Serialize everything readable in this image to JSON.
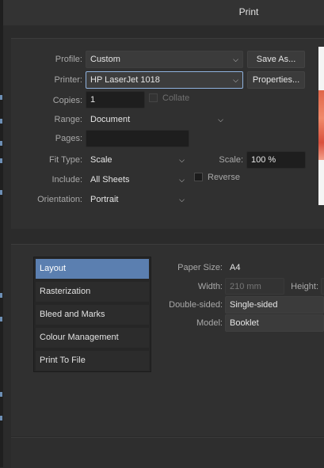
{
  "window": {
    "title": "Print"
  },
  "settings": {
    "profile": {
      "label": "Profile:",
      "value": "Custom"
    },
    "save_as_label": "Save As...",
    "printer": {
      "label": "Printer:",
      "value": "HP LaserJet 1018"
    },
    "properties_label": "Properties...",
    "copies": {
      "label": "Copies:",
      "value": "1"
    },
    "collate_label": "Collate",
    "range": {
      "label": "Range:",
      "value": "Document"
    },
    "pages": {
      "label": "Pages:",
      "value": ""
    },
    "fit_type": {
      "label": "Fit Type:",
      "value": "Scale"
    },
    "scale": {
      "label": "Scale:",
      "value": "100 %"
    },
    "include": {
      "label": "Include:",
      "value": "All Sheets"
    },
    "reverse_label": "Reverse",
    "orientation": {
      "label": "Orientation:",
      "value": "Portrait"
    }
  },
  "categories": [
    "Layout",
    "Rasterization",
    "Bleed and Marks",
    "Colour Management",
    "Print To File"
  ],
  "selected_category": "Layout",
  "layout": {
    "paper_size": {
      "label": "Paper Size:",
      "value": "A4"
    },
    "width": {
      "label": "Width:",
      "value": "210 mm"
    },
    "height": {
      "label": "Height:"
    },
    "double_sided": {
      "label": "Double-sided:",
      "value": "Single-sided"
    },
    "model": {
      "label": "Model:",
      "value": "Booklet"
    }
  },
  "colors": {
    "accent": "#5b7fb0",
    "focus_border": "#8fb2de"
  }
}
